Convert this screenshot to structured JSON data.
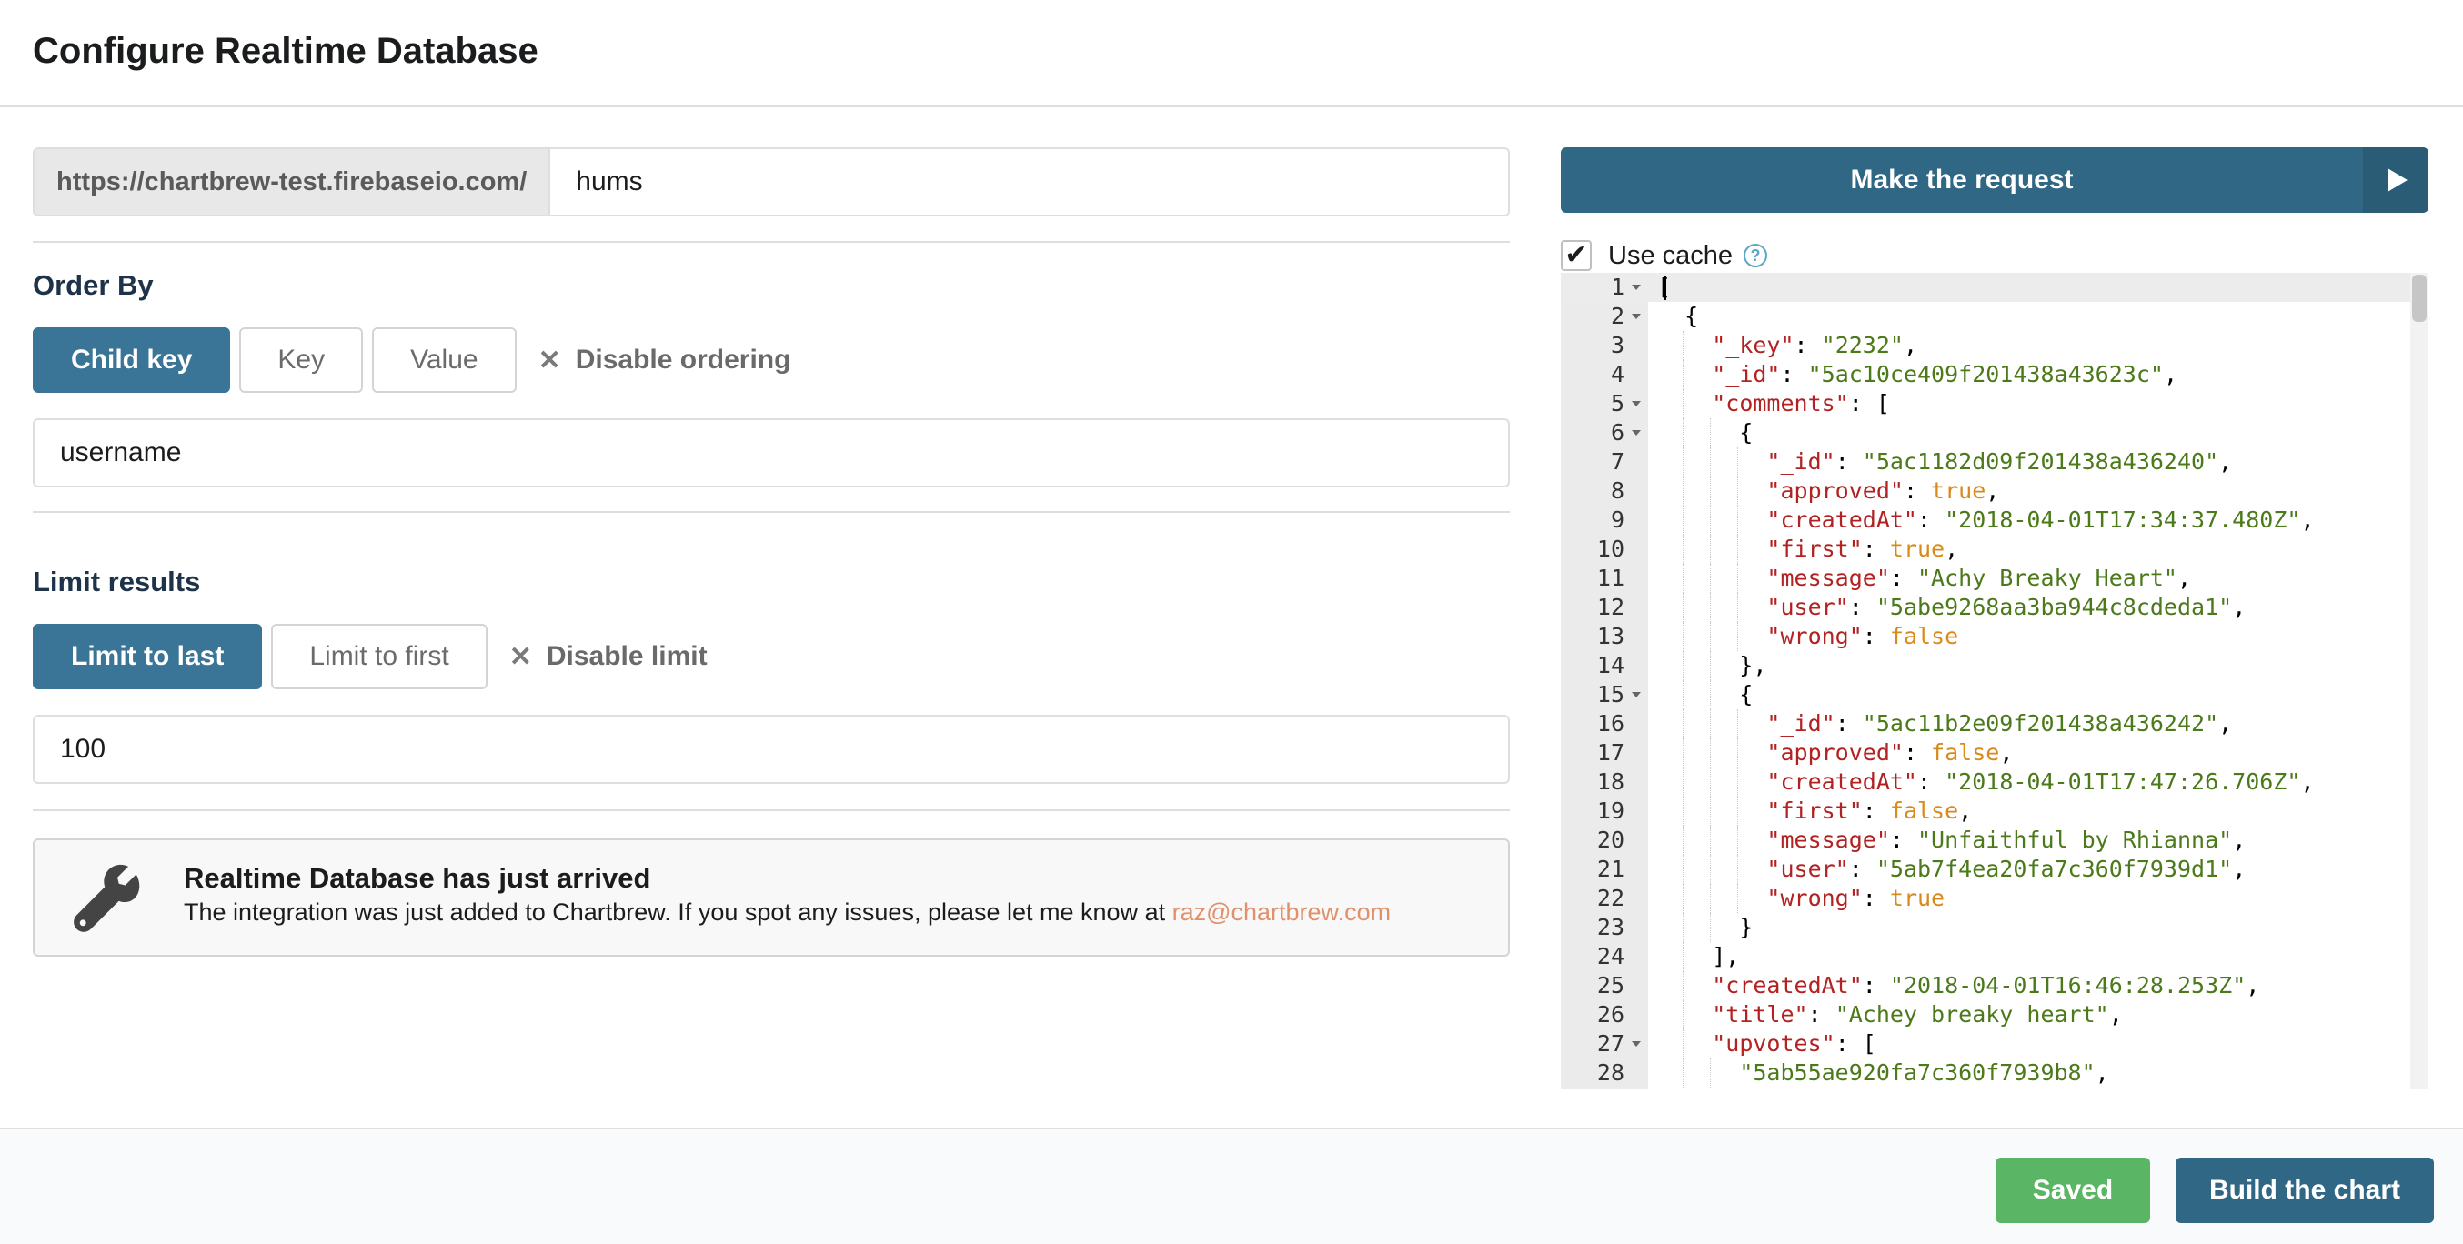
{
  "header": {
    "title": "Configure Realtime Database"
  },
  "url": {
    "prefix": "https://chartbrew-test.firebaseio.com/",
    "value": "hums"
  },
  "order_by": {
    "label": "Order By",
    "options": [
      "Child key",
      "Key",
      "Value"
    ],
    "selected": "Child key",
    "disable_label": "Disable ordering",
    "field_value": "username"
  },
  "limit": {
    "label": "Limit results",
    "options": [
      "Limit to last",
      "Limit to first"
    ],
    "selected": "Limit to last",
    "disable_label": "Disable limit",
    "field_value": "100"
  },
  "message": {
    "title": "Realtime Database has just arrived",
    "body": "The integration was just added to Chartbrew. If you spot any issues, please let me know at ",
    "email": "raz@chartbrew.com",
    "icon": "wrench-icon"
  },
  "request": {
    "button_label": "Make the request",
    "icon": "play-icon"
  },
  "cache": {
    "label": "Use cache",
    "checked": true,
    "help_icon": "question-circle-icon"
  },
  "editor": {
    "lines": [
      {
        "n": "1",
        "text": "["
      },
      {
        "n": "2",
        "text": "  {"
      },
      {
        "n": "3",
        "text": "    \"_key\": \"2232\","
      },
      {
        "n": "4",
        "text": "    \"_id\": \"5ac10ce409f201438a43623c\","
      },
      {
        "n": "5",
        "text": "    \"comments\": ["
      },
      {
        "n": "6",
        "text": "      {"
      },
      {
        "n": "7",
        "text": "        \"_id\": \"5ac1182d09f201438a436240\","
      },
      {
        "n": "8",
        "text": "        \"approved\": true,"
      },
      {
        "n": "9",
        "text": "        \"createdAt\": \"2018-04-01T17:34:37.480Z\","
      },
      {
        "n": "10",
        "text": "        \"first\": true,"
      },
      {
        "n": "11",
        "text": "        \"message\": \"Achy Breaky Heart\","
      },
      {
        "n": "12",
        "text": "        \"user\": \"5abe9268aa3ba944c8cdeda1\","
      },
      {
        "n": "13",
        "text": "        \"wrong\": false"
      },
      {
        "n": "14",
        "text": "      },"
      },
      {
        "n": "15",
        "text": "      {"
      },
      {
        "n": "16",
        "text": "        \"_id\": \"5ac11b2e09f201438a436242\","
      },
      {
        "n": "17",
        "text": "        \"approved\": false,"
      },
      {
        "n": "18",
        "text": "        \"createdAt\": \"2018-04-01T17:47:26.706Z\","
      },
      {
        "n": "19",
        "text": "        \"first\": false,"
      },
      {
        "n": "20",
        "text": "        \"message\": \"Unfaithful by Rhianna\","
      },
      {
        "n": "21",
        "text": "        \"user\": \"5ab7f4ea20fa7c360f7939d1\","
      },
      {
        "n": "22",
        "text": "        \"wrong\": true"
      },
      {
        "n": "23",
        "text": "      }"
      },
      {
        "n": "24",
        "text": "    ],"
      },
      {
        "n": "25",
        "text": "    \"createdAt\": \"2018-04-01T16:46:28.253Z\","
      },
      {
        "n": "26",
        "text": "    \"title\": \"Achey breaky heart\","
      },
      {
        "n": "27",
        "text": "    \"upvotes\": ["
      },
      {
        "n": "28",
        "text": "      \"5ab55ae920fa7c360f7939b8\","
      }
    ],
    "fold_lines": [
      "1",
      "2",
      "5",
      "6",
      "15",
      "27"
    ]
  },
  "footer": {
    "saved_label": "Saved",
    "build_label": "Build the chart"
  },
  "colors": {
    "primary": "#3a7497",
    "primary_dark": "#2f6784",
    "success": "#5ab565",
    "link": "#e0906b",
    "json_key": "#b22222",
    "json_string": "#4c7a1a",
    "json_boolean": "#d98a1b"
  }
}
